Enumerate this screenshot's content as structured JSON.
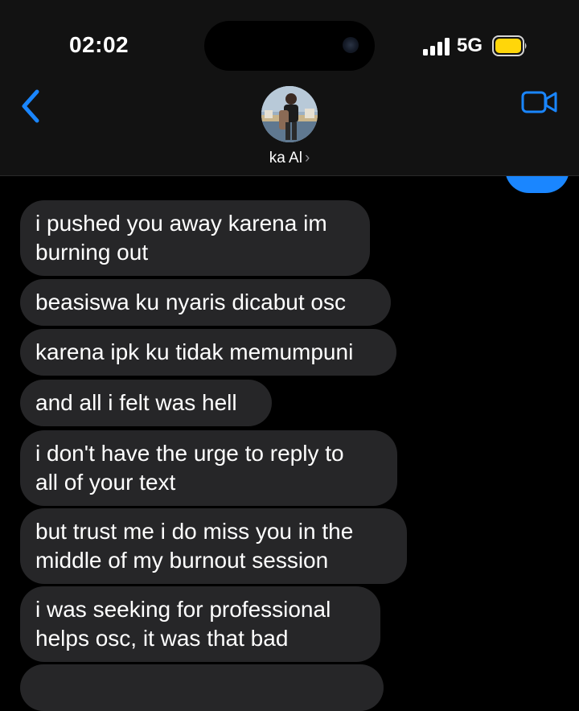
{
  "status_bar": {
    "time": "02:02",
    "network": "5G",
    "battery_color": "#ffd60a"
  },
  "header": {
    "back_icon": "chevron-left-icon",
    "video_icon": "video-camera-icon",
    "contact_name": "ka Al",
    "contact_chevron": "›",
    "accent_color": "#1a86ff"
  },
  "messages": [
    {
      "lines": [
        "i pushed you away karena im",
        "burning out"
      ]
    },
    {
      "lines": [
        "beasiswa ku nyaris dicabut osc"
      ]
    },
    {
      "lines": [
        "karena ipk ku tidak memumpuni"
      ]
    },
    {
      "lines": [
        "and all i felt was hell"
      ]
    },
    {
      "lines": [
        "i don't have the urge to reply to",
        "all of your text"
      ]
    },
    {
      "lines": [
        "but trust me i do miss you in the",
        "middle of my burnout session"
      ]
    },
    {
      "lines": [
        "i was seeking for professional",
        "helps osc, it was that bad"
      ]
    },
    {
      "lines": [
        ""
      ]
    }
  ],
  "colors": {
    "received_bubble": "#262628",
    "background": "#000000",
    "header_bg": "#121212"
  }
}
